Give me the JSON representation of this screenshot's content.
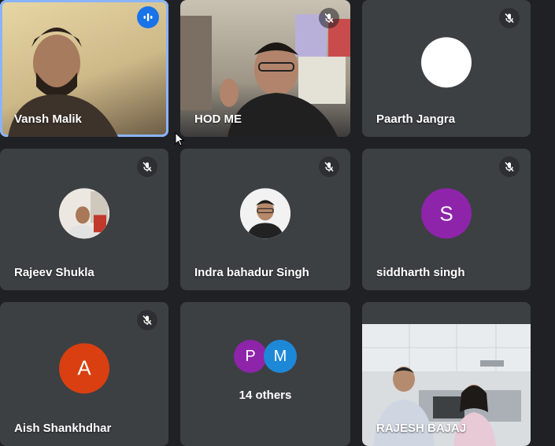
{
  "participants": [
    {
      "name": "Vansh Malik",
      "video": true,
      "speaking": true
    },
    {
      "name": "HOD ME",
      "video": true,
      "muted": true
    },
    {
      "name": "Paarth Jangra",
      "avatar_color": "#ffffff",
      "muted": true
    },
    {
      "name": "Rajeev Shukla",
      "avatar_photo": true,
      "muted": true
    },
    {
      "name": "Indra bahadur Singh",
      "avatar_photo": true,
      "muted": true
    },
    {
      "name": "siddharth singh",
      "initial": "S",
      "avatar_color": "#8e24aa",
      "muted": true
    },
    {
      "name": "Aish Shankhdhar",
      "initial": "A",
      "avatar_color": "#d93f11",
      "muted": true
    },
    {
      "name": "RAJESH BAJAJ",
      "video": true
    }
  ],
  "others": {
    "label": "14 others",
    "avatars": [
      {
        "initial": "P",
        "color": "#8e24aa"
      },
      {
        "initial": "M",
        "color": "#1e88d8"
      }
    ]
  },
  "colors": {
    "background": "#1f2124",
    "tile": "#3c4043",
    "active_border": "#8ab4f8",
    "speaking_indicator": "#1a73e8"
  }
}
